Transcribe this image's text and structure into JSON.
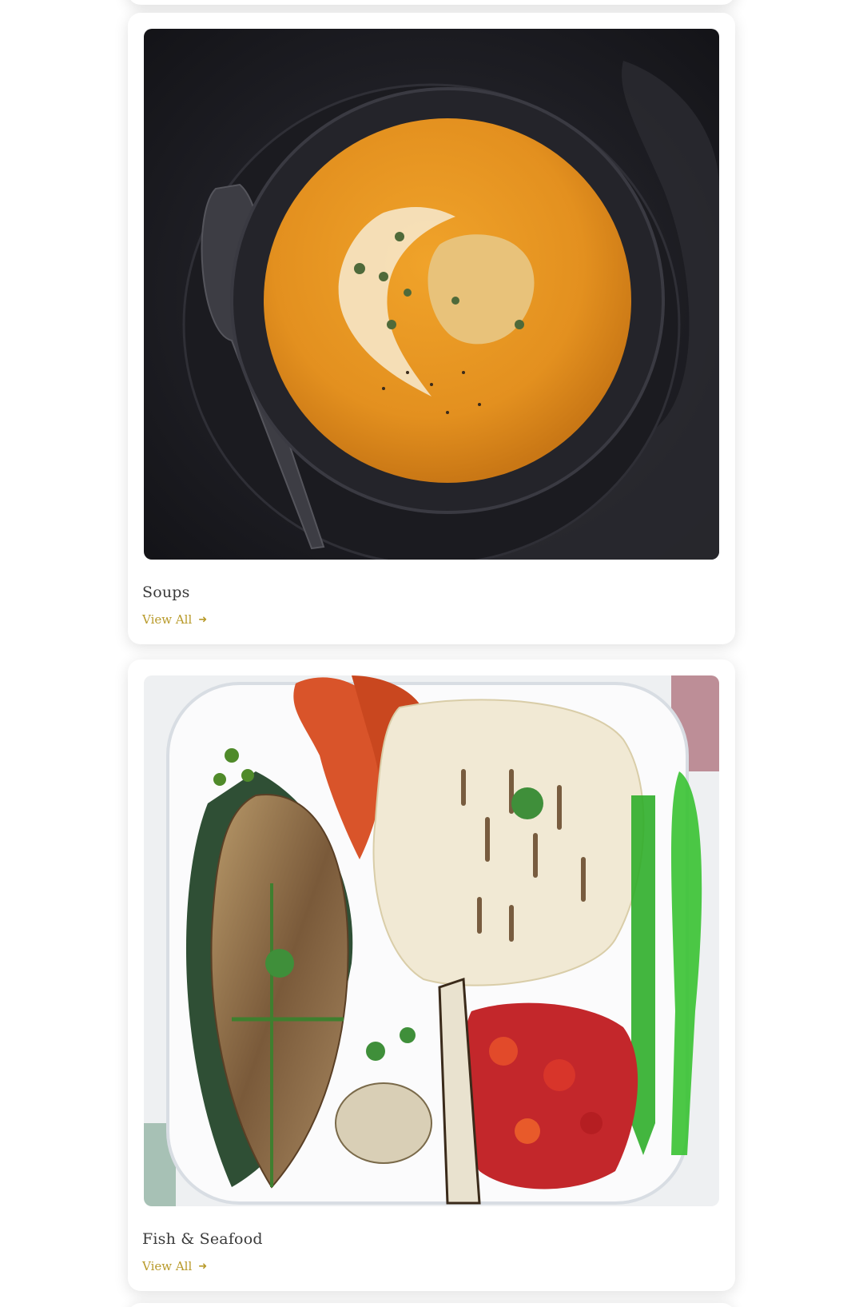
{
  "categories": [
    {
      "name": "Soups",
      "link_label": "View All",
      "link_icon": "arrow-right-icon",
      "image_desc": "bowl-of-pumpkin-soup"
    },
    {
      "name": "Fish & Seafood",
      "link_label": "View All",
      "link_icon": "arrow-right-icon",
      "image_desc": "grilled-fish-and-seafood-platter"
    }
  ],
  "colors": {
    "accent": "#b89a2a",
    "title": "#3a3a3a",
    "card_bg": "#ffffff"
  }
}
